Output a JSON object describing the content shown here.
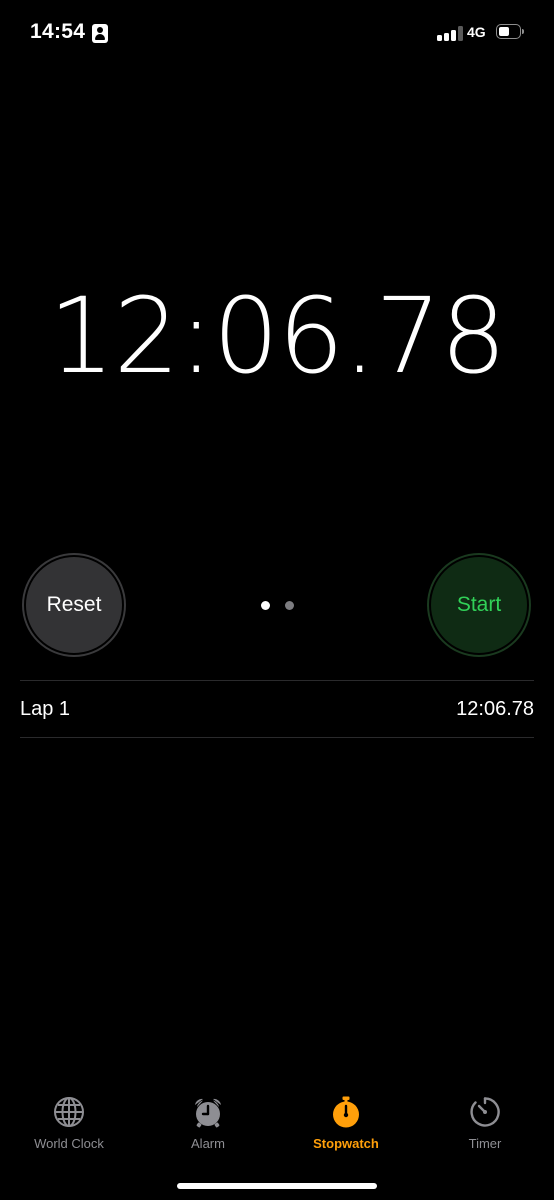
{
  "status_bar": {
    "time": "14:54",
    "network": "4G",
    "battery_level": 0.55,
    "signal_bars": 3,
    "signal_bars_total": 4
  },
  "stopwatch": {
    "elapsed": "12:06.78",
    "reset_label": "Reset",
    "start_label": "Start",
    "page_count": 2,
    "active_page": 1
  },
  "laps": [
    {
      "label": "Lap 1",
      "time": "12:06.78"
    }
  ],
  "tabs": [
    {
      "label": "World Clock",
      "icon": "globe-icon",
      "active": false
    },
    {
      "label": "Alarm",
      "icon": "alarm-clock-icon",
      "active": false
    },
    {
      "label": "Stopwatch",
      "icon": "stopwatch-icon",
      "active": true
    },
    {
      "label": "Timer",
      "icon": "timer-icon",
      "active": false
    }
  ],
  "colors": {
    "background": "#000000",
    "accent": "#ff9f0a",
    "start_text": "#31d158",
    "tab_inactive": "#8e8e93",
    "dot_active": "#ffffff",
    "dot_inactive": "#7c7c80"
  }
}
